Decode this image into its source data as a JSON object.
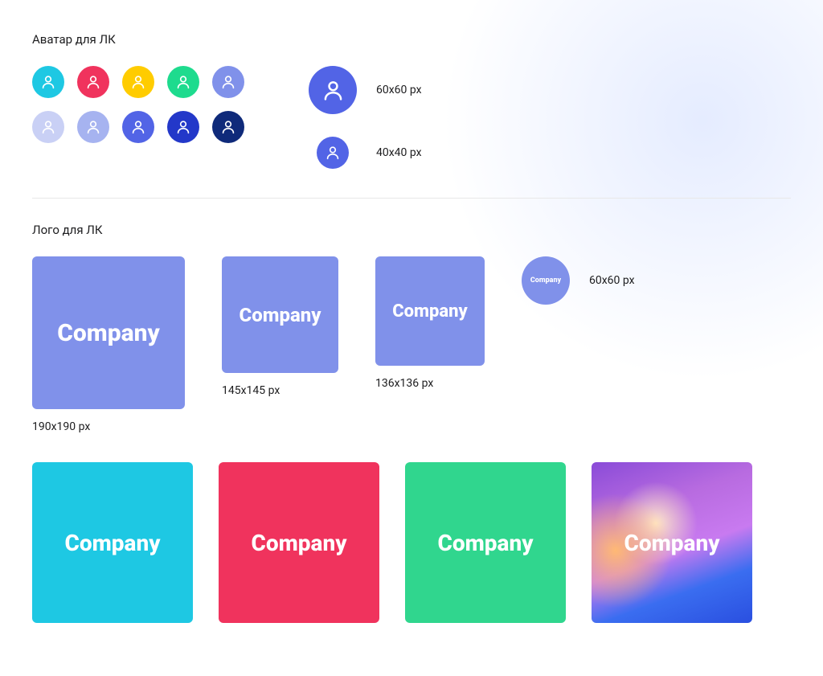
{
  "avatar_section": {
    "title": "Аватар для ЛК",
    "swatches_row1": [
      {
        "bg": "#1ec8e3",
        "fg": "#ffffff"
      },
      {
        "bg": "#f0335d",
        "fg": "#ffffff"
      },
      {
        "bg": "#ffcc00",
        "fg": "#ffffff"
      },
      {
        "bg": "#1edb8e",
        "fg": "#ffffff"
      },
      {
        "bg": "#8091ea",
        "fg": "#ffffff"
      }
    ],
    "swatches_row2": [
      {
        "bg": "#c9d0f5",
        "fg": "#ffffff"
      },
      {
        "bg": "#a6b3f0",
        "fg": "#ffffff"
      },
      {
        "bg": "#5264e6",
        "fg": "#ffffff"
      },
      {
        "bg": "#2338c9",
        "fg": "#ffffff"
      },
      {
        "bg": "#0f2a7a",
        "fg": "#ffffff"
      }
    ],
    "specimens": [
      {
        "size": 60,
        "label": "60x60 px",
        "bg": "#5264e6"
      },
      {
        "size": 40,
        "label": "40x40 px",
        "bg": "#5264e6"
      }
    ]
  },
  "logo_section": {
    "title": "Лого для ЛК",
    "company_label": "Company",
    "size_tiles": [
      {
        "size": 190,
        "font": 30,
        "label": "190х190 рх",
        "bg": "#8091ea"
      },
      {
        "size": 145,
        "font": 24,
        "label": "145х145 рх",
        "bg": "#8091ea"
      },
      {
        "size": 136,
        "font": 22,
        "label": "136х136 рх",
        "bg": "#8091ea"
      }
    ],
    "circle": {
      "size": 60,
      "label": "60x60 px",
      "bg": "#8091ea"
    },
    "color_tiles": [
      {
        "bg": "#1ec8e3",
        "gradient": false
      },
      {
        "bg": "#f0335d",
        "gradient": false
      },
      {
        "bg": "#30d68e",
        "gradient": false
      },
      {
        "bg": "",
        "gradient": true
      }
    ],
    "color_tile_size": 200,
    "color_tile_font": 28
  }
}
